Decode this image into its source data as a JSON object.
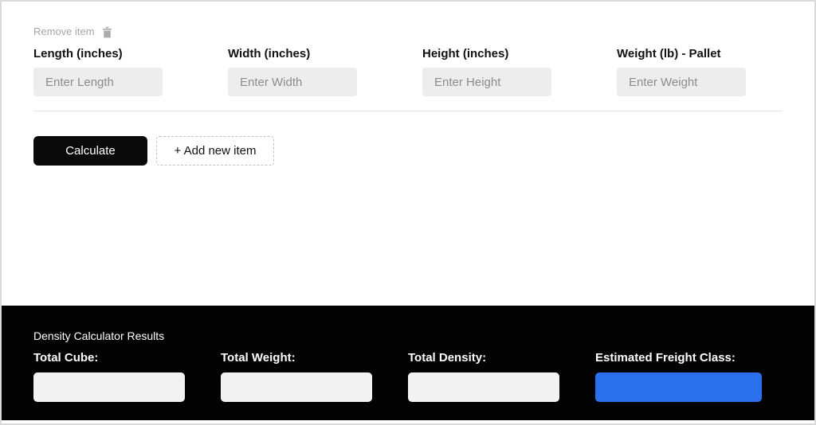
{
  "colors": {
    "accent-blue": "#2a70ec",
    "footer-bg": "#030303",
    "button-bg": "#0a0a0a",
    "field-bg": "#ededed",
    "result-field-bg": "#f2f2f2"
  },
  "icons": {
    "remove": "trash-icon"
  },
  "item_row": {
    "remove_label": "Remove item",
    "fields": [
      {
        "label": "Length (inches)",
        "placeholder": "Enter Length",
        "value": ""
      },
      {
        "label": "Width (inches)",
        "placeholder": "Enter Width",
        "value": ""
      },
      {
        "label": "Height (inches)",
        "placeholder": "Enter Height",
        "value": ""
      },
      {
        "label": "Weight (lb) - Pallet",
        "placeholder": "Enter Weight",
        "value": ""
      }
    ]
  },
  "actions": {
    "calculate_label": "Calculate",
    "add_item_label": "+ Add new item"
  },
  "results": {
    "title": "Density Calculator Results",
    "fields": [
      {
        "label": "Total Cube:",
        "value": "",
        "highlighted": false
      },
      {
        "label": "Total Weight:",
        "value": "",
        "highlighted": false
      },
      {
        "label": "Total Density:",
        "value": "",
        "highlighted": false
      },
      {
        "label": "Estimated Freight Class:",
        "value": "",
        "highlighted": true
      }
    ]
  }
}
